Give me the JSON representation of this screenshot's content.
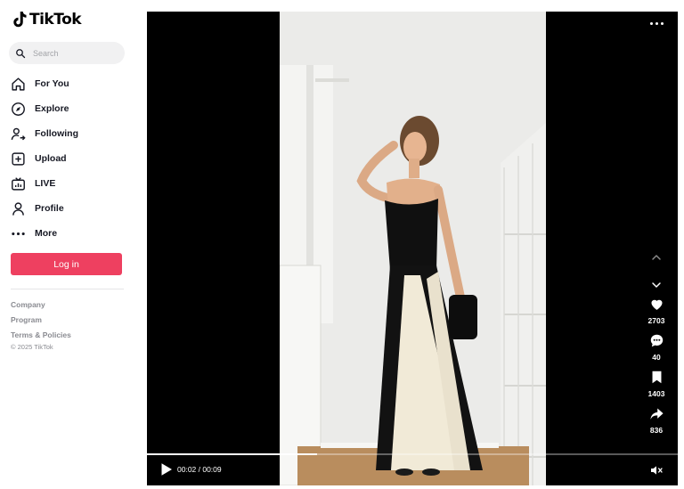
{
  "app": {
    "logo_text": "TikTok"
  },
  "search": {
    "placeholder": "Search"
  },
  "nav": {
    "items": [
      {
        "label": "For You",
        "icon": "home-icon"
      },
      {
        "label": "Explore",
        "icon": "compass-icon"
      },
      {
        "label": "Following",
        "icon": "following-icon"
      },
      {
        "label": "Upload",
        "icon": "plus-square-icon"
      },
      {
        "label": "LIVE",
        "icon": "live-tv-icon"
      },
      {
        "label": "Profile",
        "icon": "person-icon"
      },
      {
        "label": "More",
        "icon": "more-dots-icon"
      }
    ]
  },
  "login": {
    "label": "Log in",
    "color": "#ee4060"
  },
  "footer": {
    "links": [
      "Company",
      "Program",
      "Terms & Policies"
    ],
    "copyright": "© 2025 TikTok"
  },
  "player": {
    "actions": {
      "likes": "2703",
      "comments": "40",
      "saves": "1403",
      "shares": "836"
    },
    "time": "00:02 / 00:09",
    "progress_fraction": 0.32
  }
}
